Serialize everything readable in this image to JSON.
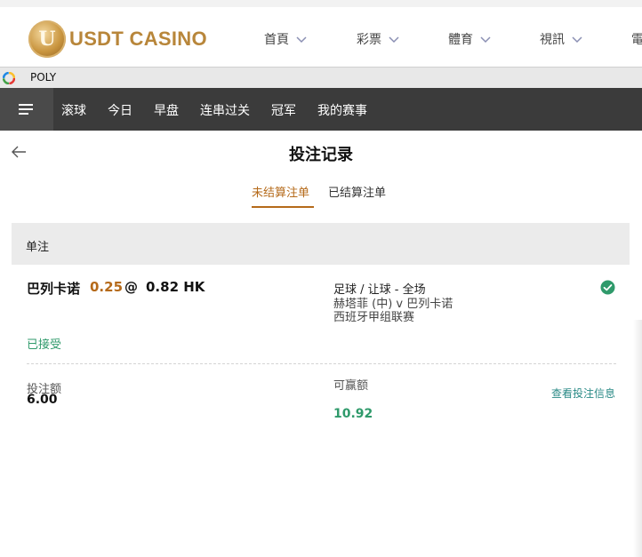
{
  "site": {
    "brand": "USDT CASINO",
    "logo_letter": "U",
    "nav": [
      {
        "label": "首頁"
      },
      {
        "label": "彩票"
      },
      {
        "label": "體育"
      },
      {
        "label": "視訊"
      },
      {
        "label": "電"
      }
    ]
  },
  "poly": {
    "label": "POLY",
    "icon": "poly-logo-icon"
  },
  "sports_nav": {
    "menu_icon": "hamburger-menu-icon",
    "tabs": [
      {
        "label": "滚球"
      },
      {
        "label": "今日"
      },
      {
        "label": "早盘"
      },
      {
        "label": "连串过关"
      },
      {
        "label": "冠军"
      },
      {
        "label": "我的赛事"
      }
    ]
  },
  "page": {
    "title": "投注记录",
    "back_icon": "back-arrow-icon",
    "tabs": [
      {
        "label": "未结算注单",
        "active": true
      },
      {
        "label": "已结算注单",
        "active": false
      }
    ]
  },
  "section": {
    "label": "单注"
  },
  "bet": {
    "selection": "巴列卡诺",
    "handicap": "0.25",
    "at": "@",
    "odds": "0.82 HK",
    "market": "足球 / 让球 - 全场",
    "match": "赫塔菲 (中) v 巴列卡诺",
    "league": "西班牙甲组联赛",
    "status": "已接受",
    "status_icon": "check-circle-icon",
    "stake_label": "投注额",
    "stake_value": "6.00",
    "win_label": "可赢额",
    "win_value": "10.92",
    "view_link": "查看投注信息"
  },
  "colors": {
    "accent": "#b56a1a",
    "success": "#2f9a6b",
    "link": "#2a8a86",
    "nav_bg": "#3b3b3b",
    "gold": "#b8863a"
  }
}
